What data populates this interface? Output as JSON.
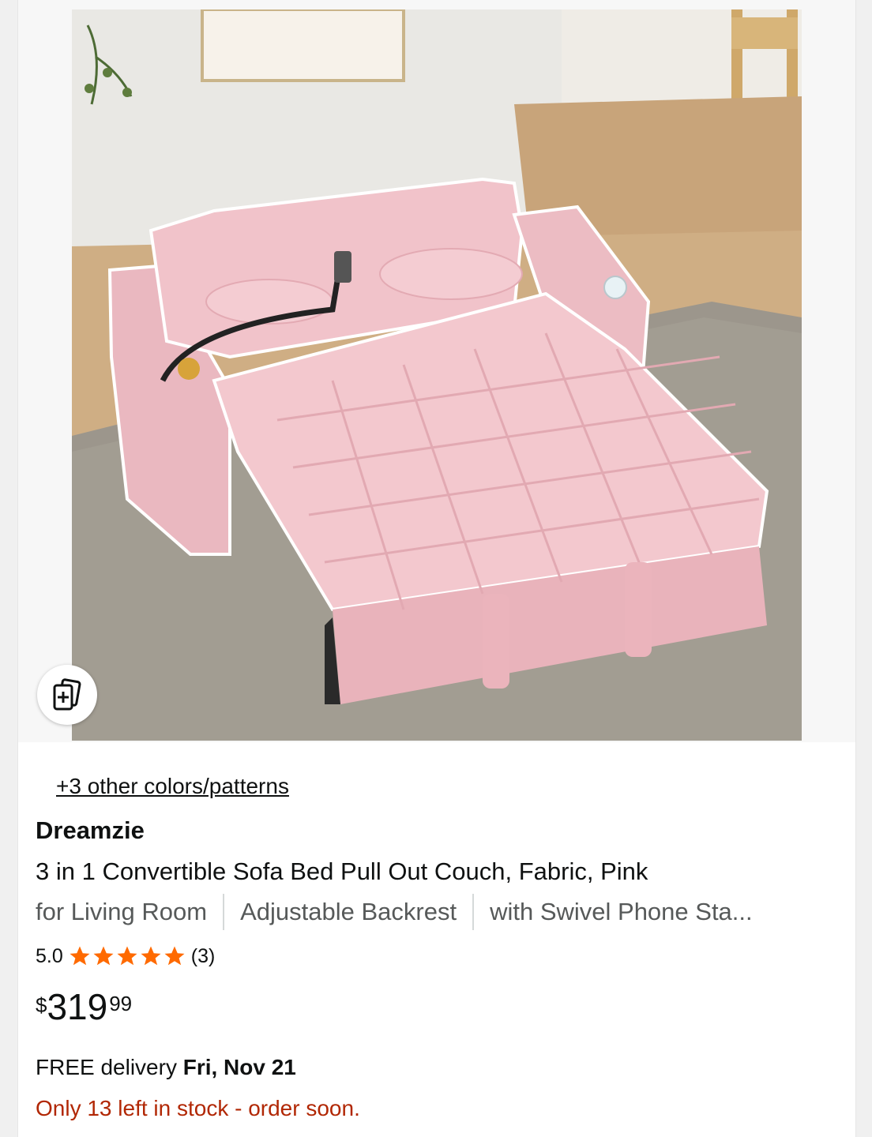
{
  "product": {
    "image_alt": "Pink convertible sofa bed product photo",
    "colors_link": "+3 other colors/patterns",
    "brand": "Dreamzie",
    "title": "3 in 1 Convertible Sofa Bed Pull Out Couch, Fabric, Pink",
    "features": [
      "for Living Room",
      "Adjustable Backrest",
      "with Swivel Phone Sta..."
    ],
    "rating": {
      "value": "5.0",
      "stars": 5,
      "count": "(3)",
      "star_color": "#ff6a00"
    },
    "price": {
      "symbol": "$",
      "whole": "319",
      "fraction": "99"
    },
    "delivery": {
      "prefix": "FREE delivery",
      "date": "Fri, Nov 21"
    },
    "stock": {
      "text": "Only 13 left in stock - order soon.",
      "color": "#b12704"
    },
    "compare_icon": "compare-add-icon"
  }
}
